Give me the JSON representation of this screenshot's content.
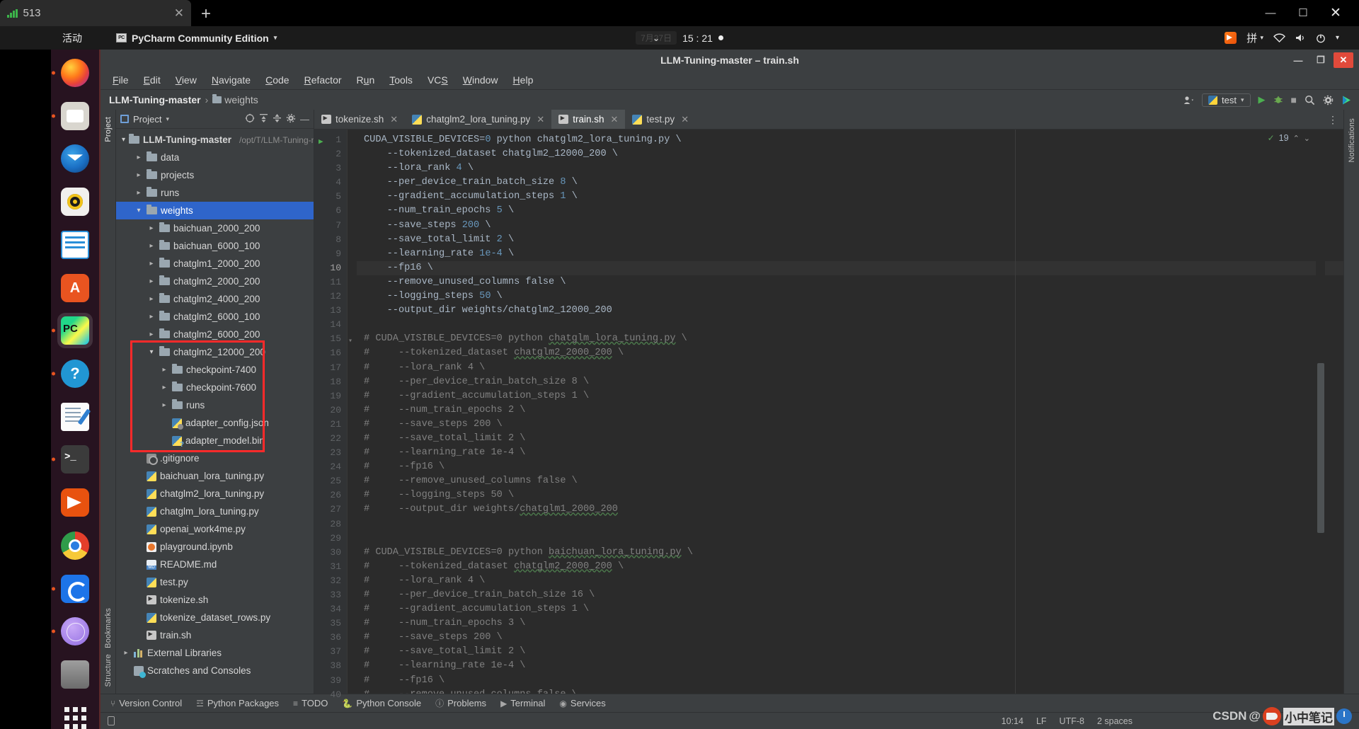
{
  "outer": {
    "tab_label": "513",
    "close_icon": "close-icon",
    "newtab_icon": "plus-icon",
    "window_controls": [
      "minimize",
      "maximize",
      "close"
    ],
    "minimize_glyph": "—",
    "maximize_glyph": "☐",
    "close_glyph": "✕"
  },
  "gnome_panel": {
    "activities": "活动",
    "app_name": "PyCharm Community Edition",
    "app_icon": "PC",
    "caret": "▾",
    "date_chip": "7月27日",
    "clock": "15 : 21",
    "tray": {
      "sogou_icon": "sogou-ime-icon",
      "ime_label": "拼",
      "ime_caret": "▾",
      "wifi_icon": "wifi-icon",
      "volume_icon": "volume-icon",
      "power_icon": "power-icon",
      "menu_caret": "▾"
    }
  },
  "dock": {
    "items": [
      {
        "name": "firefox",
        "running": true
      },
      {
        "name": "files",
        "running": true
      },
      {
        "name": "thunderbird",
        "running": false
      },
      {
        "name": "rhythmbox",
        "running": false
      },
      {
        "name": "libreoffice-writer",
        "running": false
      },
      {
        "name": "ubuntu-software",
        "running": false
      },
      {
        "name": "pycharm",
        "running": true,
        "active": true
      },
      {
        "name": "help",
        "running": true
      },
      {
        "name": "text-editor",
        "running": false
      },
      {
        "name": "terminal",
        "running": true
      },
      {
        "name": "video-player",
        "running": false
      },
      {
        "name": "google-chrome",
        "running": false
      },
      {
        "name": "sync-app",
        "running": true
      },
      {
        "name": "network-globe",
        "running": true
      },
      {
        "name": "trash",
        "running": false
      }
    ],
    "show_apps": "show-applications"
  },
  "window": {
    "title": "LLM-Tuning-master – train.sh",
    "minimize_glyph": "—",
    "maximize_glyph": "❐",
    "close_glyph": "✕"
  },
  "menu": {
    "items": [
      {
        "pre": "",
        "hot": "F",
        "post": "ile"
      },
      {
        "pre": "",
        "hot": "E",
        "post": "dit"
      },
      {
        "pre": "",
        "hot": "V",
        "post": "iew"
      },
      {
        "pre": "",
        "hot": "N",
        "post": "avigate"
      },
      {
        "pre": "",
        "hot": "C",
        "post": "ode"
      },
      {
        "pre": "",
        "hot": "R",
        "post": "efactor"
      },
      {
        "pre": "R",
        "hot": "u",
        "post": "n"
      },
      {
        "pre": "",
        "hot": "T",
        "post": "ools"
      },
      {
        "pre": "VC",
        "hot": "S",
        "post": ""
      },
      {
        "pre": "",
        "hot": "W",
        "post": "indow"
      },
      {
        "pre": "",
        "hot": "H",
        "post": "elp"
      }
    ]
  },
  "navbar": {
    "breadcrumb_root": "LLM-Tuning-master",
    "breadcrumb_sep": "›",
    "breadcrumb_leaf": "weights",
    "account_icon": "account-icon",
    "account_caret": "▾",
    "run_config": "test",
    "run_icon": "run-icon",
    "debug_icon": "debug-icon",
    "stop_icon": "stop-icon",
    "search_icon": "search-icon",
    "settings_icon": "gear-icon",
    "updates_icon": "updates-icon"
  },
  "left_rail": {
    "top": [
      "Project"
    ],
    "bottom": [
      "Bookmarks",
      "Structure"
    ]
  },
  "right_rail": {
    "labels": [
      "Notifications"
    ]
  },
  "project_panel": {
    "title": "Project",
    "caret": "▾",
    "icons": [
      "locate-icon",
      "expand-all-icon",
      "collapse-all-icon",
      "gear-icon",
      "hide-icon"
    ],
    "tree": [
      {
        "depth": 0,
        "arrow": "open",
        "icon": "folder",
        "label": "LLM-Tuning-master",
        "path": "/opt/T/LLM-Tuning-m",
        "bold": true
      },
      {
        "depth": 1,
        "arrow": "closed",
        "icon": "folder",
        "label": "data"
      },
      {
        "depth": 1,
        "arrow": "closed",
        "icon": "folder",
        "label": "projects"
      },
      {
        "depth": 1,
        "arrow": "closed",
        "icon": "folder",
        "label": "runs"
      },
      {
        "depth": 1,
        "arrow": "open",
        "icon": "folder",
        "label": "weights",
        "selected": true
      },
      {
        "depth": 2,
        "arrow": "closed",
        "icon": "folder",
        "label": "baichuan_2000_200"
      },
      {
        "depth": 2,
        "arrow": "closed",
        "icon": "folder",
        "label": "baichuan_6000_100"
      },
      {
        "depth": 2,
        "arrow": "closed",
        "icon": "folder",
        "label": "chatglm1_2000_200"
      },
      {
        "depth": 2,
        "arrow": "closed",
        "icon": "folder",
        "label": "chatglm2_2000_200"
      },
      {
        "depth": 2,
        "arrow": "closed",
        "icon": "folder",
        "label": "chatglm2_4000_200"
      },
      {
        "depth": 2,
        "arrow": "closed",
        "icon": "folder",
        "label": "chatglm2_6000_100"
      },
      {
        "depth": 2,
        "arrow": "closed",
        "icon": "folder",
        "label": "chatglm2_6000_200"
      },
      {
        "depth": 2,
        "arrow": "open",
        "icon": "folder",
        "label": "chatglm2_12000_200"
      },
      {
        "depth": 3,
        "arrow": "closed",
        "icon": "folder",
        "label": "checkpoint-7400"
      },
      {
        "depth": 3,
        "arrow": "closed",
        "icon": "folder",
        "label": "checkpoint-7600"
      },
      {
        "depth": 3,
        "arrow": "closed",
        "icon": "folder",
        "label": "runs"
      },
      {
        "depth": 3,
        "arrow": "none",
        "icon": "json",
        "label": "adapter_config.json"
      },
      {
        "depth": 3,
        "arrow": "none",
        "icon": "bin",
        "label": "adapter_model.bin"
      },
      {
        "depth": 1,
        "arrow": "none",
        "icon": "git",
        "label": ".gitignore"
      },
      {
        "depth": 1,
        "arrow": "none",
        "icon": "py",
        "label": "baichuan_lora_tuning.py"
      },
      {
        "depth": 1,
        "arrow": "none",
        "icon": "py",
        "label": "chatglm2_lora_tuning.py"
      },
      {
        "depth": 1,
        "arrow": "none",
        "icon": "py",
        "label": "chatglm_lora_tuning.py"
      },
      {
        "depth": 1,
        "arrow": "none",
        "icon": "py",
        "label": "openai_work4me.py"
      },
      {
        "depth": 1,
        "arrow": "none",
        "icon": "ipynb",
        "label": "playground.ipynb"
      },
      {
        "depth": 1,
        "arrow": "none",
        "icon": "md",
        "label": "README.md"
      },
      {
        "depth": 1,
        "arrow": "none",
        "icon": "py",
        "label": "test.py"
      },
      {
        "depth": 1,
        "arrow": "none",
        "icon": "sh",
        "label": "tokenize.sh"
      },
      {
        "depth": 1,
        "arrow": "none",
        "icon": "py",
        "label": "tokenize_dataset_rows.py"
      },
      {
        "depth": 1,
        "arrow": "none",
        "icon": "sh",
        "label": "train.sh"
      },
      {
        "depth": 0,
        "arrow": "closed",
        "icon": "lib",
        "label": "External Libraries"
      },
      {
        "depth": 0,
        "arrow": "none",
        "icon": "scratch",
        "label": "Scratches and Consoles"
      }
    ],
    "highlight_color": "#ff2a2a"
  },
  "editor": {
    "tabs": [
      {
        "label": "tokenize.sh",
        "icon": "sh",
        "active": false
      },
      {
        "label": "chatglm2_lora_tuning.py",
        "icon": "py",
        "active": false
      },
      {
        "label": "train.sh",
        "icon": "sh",
        "active": true
      },
      {
        "label": "test.py",
        "icon": "py",
        "active": false
      }
    ],
    "tabs_more_icon": "more-icon",
    "inspection": {
      "count": "19",
      "check_icon": "check-icon",
      "up": "⌃",
      "down": "⌄"
    },
    "current_line": 10,
    "lines": [
      "CUDA_VISIBLE_DEVICES=0 python chatglm2_lora_tuning.py \\",
      "    --tokenized_dataset chatglm2_12000_200 \\",
      "    --lora_rank 4 \\",
      "    --per_device_train_batch_size 8 \\",
      "    --gradient_accumulation_steps 1 \\",
      "    --num_train_epochs 5 \\",
      "    --save_steps 200 \\",
      "    --save_total_limit 2 \\",
      "    --learning_rate 1e-4 \\",
      "    --fp16 \\",
      "    --remove_unused_columns false \\",
      "    --logging_steps 50 \\",
      "    --output_dir weights/chatglm2_12000_200",
      "",
      "# CUDA_VISIBLE_DEVICES=0 python chatglm_lora_tuning.py \\",
      "#     --tokenized_dataset chatglm2_2000_200 \\",
      "#     --lora_rank 4 \\",
      "#     --per_device_train_batch_size 8 \\",
      "#     --gradient_accumulation_steps 1 \\",
      "#     --num_train_epochs 2 \\",
      "#     --save_steps 200 \\",
      "#     --save_total_limit 2 \\",
      "#     --learning_rate 1e-4 \\",
      "#     --fp16 \\",
      "#     --remove_unused_columns false \\",
      "#     --logging_steps 50 \\",
      "#     --output_dir weights/chatglm1_2000_200",
      "",
      "",
      "# CUDA_VISIBLE_DEVICES=0 python baichuan_lora_tuning.py \\",
      "#     --tokenized_dataset chatglm2_2000_200 \\",
      "#     --lora_rank 4 \\",
      "#     --per_device_train_batch_size 16 \\",
      "#     --gradient_accumulation_steps 1 \\",
      "#     --num_train_epochs 3 \\",
      "#     --save_steps 200 \\",
      "#     --save_total_limit 2 \\",
      "#     --learning_rate 1e-4 \\",
      "#     --fp16 \\",
      "#     --remove_unused_columns false \\"
    ]
  },
  "tool_windows": [
    {
      "label": "Version Control",
      "icon": "branch-icon"
    },
    {
      "label": "Python Packages",
      "icon": "packages-icon"
    },
    {
      "label": "TODO",
      "icon": "list-icon"
    },
    {
      "label": "Python Console",
      "icon": "python-icon"
    },
    {
      "label": "Problems",
      "icon": "warning-icon"
    },
    {
      "label": "Terminal",
      "icon": "terminal-icon"
    },
    {
      "label": "Services",
      "icon": "services-icon"
    }
  ],
  "status_bar": {
    "memory_icon": "memory-icon",
    "caret_position": "10:14",
    "line_separator": "LF",
    "encoding": "UTF-8",
    "indent": "2 spaces",
    "watermark": "CSDN @小中笔记"
  }
}
